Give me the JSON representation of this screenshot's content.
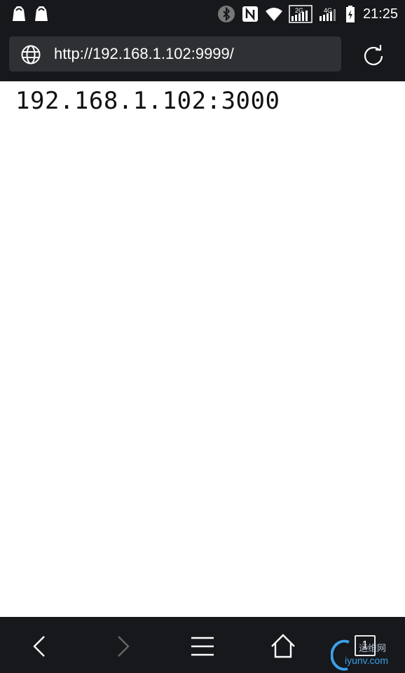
{
  "status_bar": {
    "time": "21:25",
    "signal_1_label": "2G",
    "signal_2_label": "4G",
    "icons": [
      "shopping-bag-icon",
      "shopping-bag-icon",
      "bluetooth-icon",
      "nfc-icon",
      "wifi-icon",
      "signal-icon",
      "signal-icon",
      "battery-charging-icon"
    ]
  },
  "toolbar": {
    "url": "http://192.168.1.102:9999/",
    "site_icon": "globe-icon",
    "reload_icon": "reload-icon"
  },
  "page": {
    "text": "192.168.1.102:3000"
  },
  "bottom_nav": {
    "tab_count": "1",
    "icons": [
      "back-icon",
      "forward-icon",
      "menu-icon",
      "home-icon",
      "tabs-icon"
    ]
  },
  "watermark": {
    "text_cn": "运维网",
    "text_url": "iyunv.com"
  },
  "colors": {
    "chrome_bg": "#16181c",
    "urlbar_bg": "#2e3034",
    "page_bg": "#ffffff",
    "watermark_blue": "#3ba0e8"
  }
}
